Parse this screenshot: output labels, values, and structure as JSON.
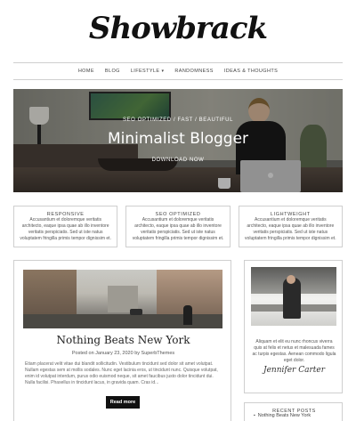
{
  "site": {
    "logo": "Showbrack"
  },
  "nav": {
    "items": [
      {
        "label": "HOME"
      },
      {
        "label": "BLOG"
      },
      {
        "label": "LIFESTYLE"
      },
      {
        "label": "RANDOMNESS"
      },
      {
        "label": "IDEAS & THOUGHTS"
      }
    ],
    "dropdown_icon": "chevron-down-icon"
  },
  "hero": {
    "kicker": "SEO OPTIMIZED / FAST / BEAUTIFUL",
    "title": "Minimalist Blogger",
    "cta": "DOWNLOAD NOW"
  },
  "features": [
    {
      "title": "RESPONSIVE",
      "text": "Accusantium et doloremque veritatis architecto, eaque ipsa quae ab illo inventore veritatis perspiciatis. Sed ut iste natus voluptatem fringilla primis tempor dignissim et."
    },
    {
      "title": "SEO OPTIMIZED",
      "text": "Accusantium et doloremque veritatis architecto, eaque ipsa quae ab illo inventore veritatis perspiciatis. Sed ut iste natus voluptatem fringilla primis tempor dignissim et."
    },
    {
      "title": "LIGHTWEIGHT",
      "text": "Accusantium et doloremque veritatis architecto, eaque ipsa quae ab illo inventore veritatis perspiciatis. Sed ut iste natus voluptatem fringilla primis tempor dignissim et."
    }
  ],
  "post": {
    "title": "Nothing Beats New York",
    "meta": "Posted on January 23, 2020 by SuperbThemes",
    "excerpt": "Etiam placerat velit vitae dui blandit sollicitudin. Vestibulum tincidunt sed dolor sit amet volutpat. Nullam egestas sem at mollis sodales. Nunc eget lacinia eros, ut tincidunt nunc. Quisque volutpat, enim id volutpat interdum, purus odio euismod neque, sit amet faucibus justo dolor tincidunt dui. Nulla facilisi. Phasellus in tincidunt lacus, in gravida quam. Cras id...",
    "more_label": "Read more"
  },
  "about": {
    "text": "Aliquam et elit eu nunc rhoncus viverra quis at felis et netus et malesuada fames ac turpis egestas. Aenean commodo ligula eget dolor.",
    "signature": "Jennifer Carter"
  },
  "recent": {
    "title": "RECENT POSTS",
    "items": [
      {
        "label": "Nothing Beats New York"
      }
    ]
  }
}
